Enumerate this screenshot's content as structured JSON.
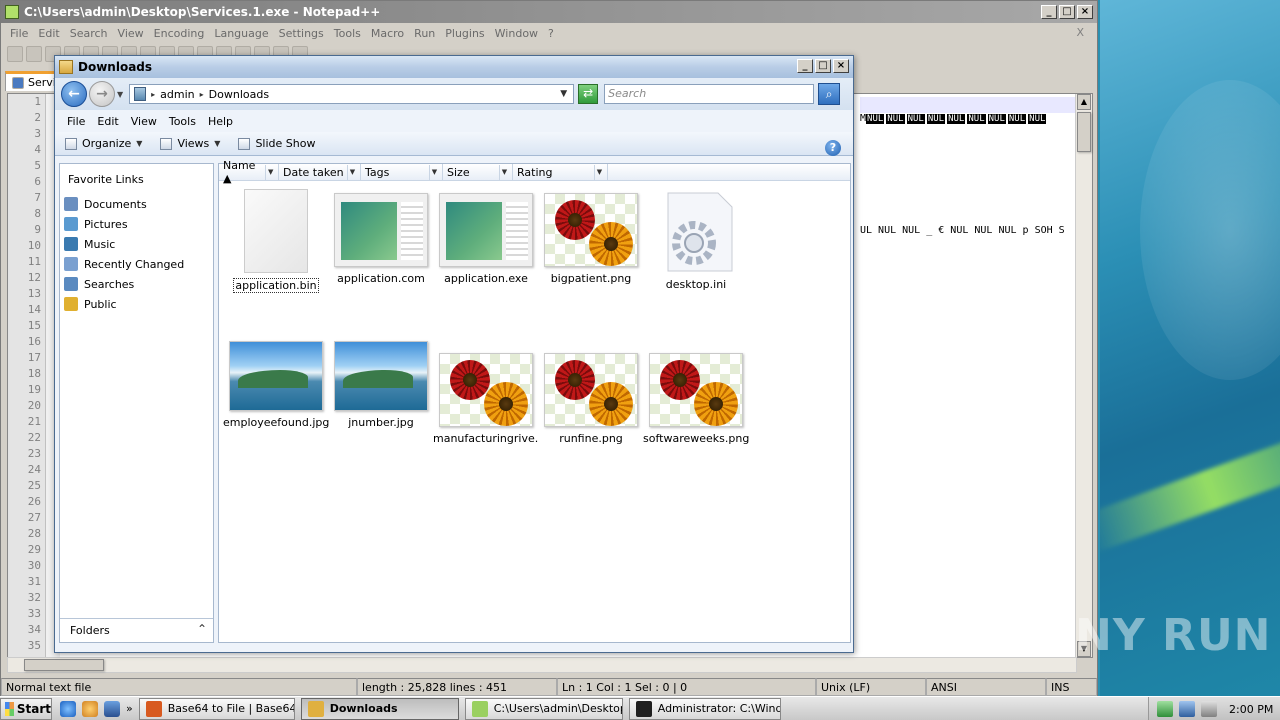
{
  "notepad": {
    "title": "C:\\Users\\admin\\Desktop\\Services.1.exe - Notepad++",
    "menu": [
      "File",
      "Edit",
      "Search",
      "View",
      "Encoding",
      "Language",
      "Settings",
      "Tools",
      "Macro",
      "Run",
      "Plugins",
      "Window",
      "?"
    ],
    "close_doc": "X",
    "tab_label": "Servic",
    "line_numbers": [
      "1",
      "2",
      "3",
      "4",
      "5",
      "6",
      "7",
      "8",
      "9",
      "10",
      "11",
      "12",
      "13",
      "14",
      "15",
      "16",
      "17",
      "18",
      "19",
      "20",
      "21",
      "22",
      "23",
      "24",
      "25",
      "26",
      "27",
      "28",
      "29",
      "30",
      "31",
      "32",
      "33",
      "34",
      "35"
    ],
    "line2_tokens": [
      "M",
      "NUL",
      "NUL",
      "NUL",
      "NUL",
      "NUL",
      "NUL",
      "NUL",
      "NUL",
      "NUL"
    ],
    "line9_text": "UL NUL NUL _  € NUL NUL NUL p SOH S",
    "status": {
      "file_type": "Normal text file",
      "length_lines": "length : 25,828    lines : 451",
      "position": "Ln : 1    Col : 1    Sel : 0 | 0",
      "eol": "Unix (LF)",
      "encoding": "ANSI",
      "mode": "INS"
    }
  },
  "explorer": {
    "title": "Downloads",
    "breadcrumb": [
      "admin",
      "Downloads"
    ],
    "search_placeholder": "Search",
    "menu": [
      "File",
      "Edit",
      "View",
      "Tools",
      "Help"
    ],
    "commands": {
      "organize": "Organize",
      "views": "Views",
      "slideshow": "Slide Show"
    },
    "favorites_header": "Favorite Links",
    "favorites": [
      {
        "label": "Documents",
        "color": "#6a8fc0"
      },
      {
        "label": "Pictures",
        "color": "#5a9ad0"
      },
      {
        "label": "Music",
        "color": "#3a7ab0"
      },
      {
        "label": "Recently Changed",
        "color": "#7aa0d0"
      },
      {
        "label": "Searches",
        "color": "#5a8ac0"
      },
      {
        "label": "Public",
        "color": "#e0b030"
      }
    ],
    "folders_label": "Folders",
    "columns": [
      "Name",
      "Date taken",
      "Tags",
      "Size",
      "Rating"
    ],
    "files": [
      {
        "name": "application.bin",
        "kind": "blank",
        "selected": true
      },
      {
        "name": "application.com",
        "kind": "app"
      },
      {
        "name": "application.exe",
        "kind": "app"
      },
      {
        "name": "bigpatient.png",
        "kind": "flower"
      },
      {
        "name": "desktop.ini",
        "kind": "gear"
      },
      {
        "name": "employeefound.jpg",
        "kind": "sea"
      },
      {
        "name": "jnumber.jpg",
        "kind": "sea"
      },
      {
        "name": "manufacturingrive...",
        "kind": "flower"
      },
      {
        "name": "runfine.png",
        "kind": "flower"
      },
      {
        "name": "softwareweeks.png",
        "kind": "flower"
      }
    ]
  },
  "taskbar": {
    "start": "Start",
    "buttons": [
      {
        "label": "Base64 to File | Base64 ...",
        "icon_color": "#d85a20",
        "active": false
      },
      {
        "label": "Downloads",
        "icon_color": "#e0b040",
        "active": true
      },
      {
        "label": "C:\\Users\\admin\\Desktop...",
        "icon_color": "#9ad060",
        "active": false
      },
      {
        "label": "Administrator: C:\\Windo...",
        "icon_color": "#202020",
        "active": false
      }
    ],
    "clock": "2:00 PM"
  },
  "watermark": "ANY RUN"
}
